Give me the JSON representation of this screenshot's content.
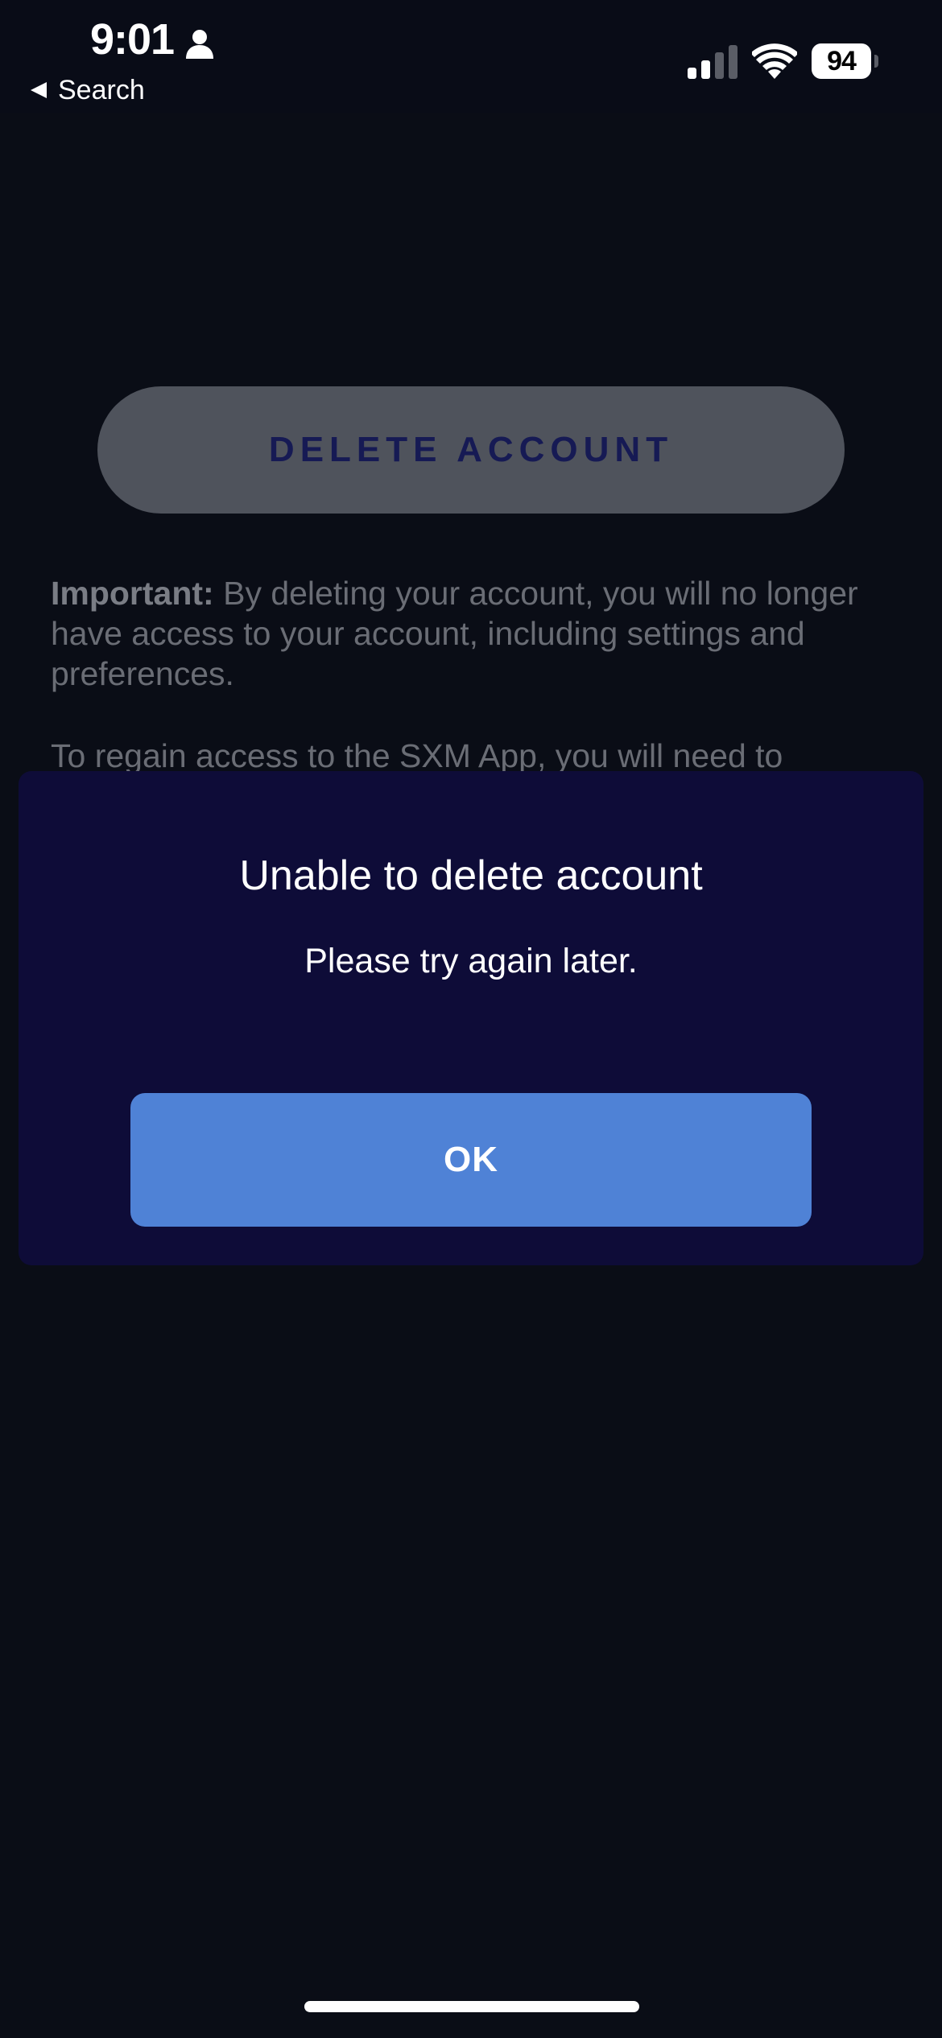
{
  "status_bar": {
    "time": "9:01",
    "back_label": "Search",
    "battery": "94",
    "icons": [
      "person-icon",
      "back-triangle-icon",
      "cellular-signal-icon",
      "wifi-icon",
      "battery-icon"
    ]
  },
  "page": {
    "delete_button_label": "DELETE ACCOUNT",
    "important_label": "Important:",
    "important_text": " By deleting your account, you will no longer have access to your account, including settings and preferences.",
    "regain_text": "To regain access to the SXM App, you will need to"
  },
  "dialog": {
    "title": "Unable to delete account",
    "message": "Please try again later.",
    "ok_label": "OK"
  },
  "colors": {
    "background": "#0a0d16",
    "dialog_background": "#0e0c38",
    "ok_button": "#4f82d6",
    "delete_button": "#4f535c",
    "delete_button_text": "#161a54"
  }
}
